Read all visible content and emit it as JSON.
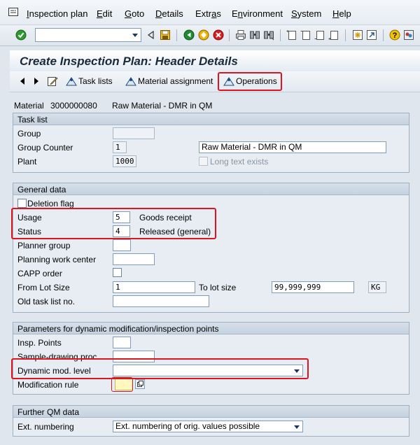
{
  "menubar": {
    "items": [
      {
        "pre": "",
        "u": "I",
        "post": "nspection plan"
      },
      {
        "pre": "",
        "u": "E",
        "post": "dit"
      },
      {
        "pre": "",
        "u": "G",
        "post": "oto"
      },
      {
        "pre": "",
        "u": "D",
        "post": "etails"
      },
      {
        "pre": "Extr",
        "u": "a",
        "post": "s"
      },
      {
        "pre": "E",
        "u": "n",
        "post": "vironment"
      },
      {
        "pre": "",
        "u": "S",
        "post": "ystem"
      },
      {
        "pre": "",
        "u": "H",
        "post": "elp"
      }
    ]
  },
  "toolbar": {
    "command_value": ""
  },
  "title": "Create Inspection Plan: Header Details",
  "app_toolbar": {
    "task_lists": "Task lists",
    "material_assignment": "Material assignment",
    "operations": "Operations"
  },
  "material": {
    "label": "Material",
    "number": "3000000080",
    "description": "Raw Material - DMR in QM"
  },
  "task_list": {
    "title": "Task list",
    "group_label": "Group",
    "group_value": "",
    "group_counter_label": "Group Counter",
    "group_counter_value": "1",
    "description_value": "Raw Material - DMR in QM",
    "plant_label": "Plant",
    "plant_value": "1000",
    "long_text_label": "Long text exists"
  },
  "general_data": {
    "title": "General data",
    "deletion_flag_label": "Deletion flag",
    "usage_label": "Usage",
    "usage_value": "5",
    "usage_text": "Goods receipt",
    "status_label": "Status",
    "status_value": "4",
    "status_text": "Released (general)",
    "planner_group_label": "Planner group",
    "planner_group_value": "",
    "planning_wc_label": "Planning work center",
    "planning_wc_value": "",
    "capp_order_label": "CAPP order",
    "from_lot_label": "From Lot Size",
    "from_lot_value": "1",
    "to_lot_label": "To lot size",
    "to_lot_value": "99,999,999",
    "unit_value": "KG",
    "old_task_list_label": "Old task list no.",
    "old_task_list_value": ""
  },
  "dynamic": {
    "title": "Parameters for dynamic modification/inspection points",
    "insp_points_label": "Insp. Points",
    "insp_points_value": "",
    "sample_drawing_label": "Sample-drawing proc.",
    "sample_drawing_value": "",
    "dyn_mod_level_label": "Dynamic mod. level",
    "dyn_mod_level_value": "",
    "mod_rule_label": "Modification rule",
    "mod_rule_value": ""
  },
  "further_qm": {
    "title": "Further QM data",
    "ext_numbering_label": "Ext. numbering",
    "ext_numbering_value": "Ext. numbering of orig. values possible"
  },
  "colors": {
    "highlight": "#e0141e",
    "background": "#dfe6ee",
    "group_header": "#c5d2df",
    "required_field": "#fff7c0"
  }
}
